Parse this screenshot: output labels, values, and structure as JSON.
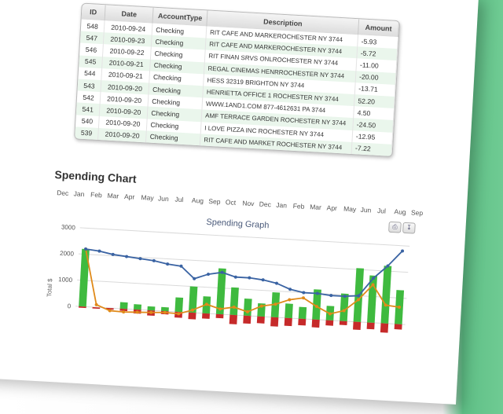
{
  "table": {
    "headers": [
      "ID",
      "Date",
      "AccountType",
      "Description",
      "Amount"
    ],
    "rows": [
      [
        "548",
        "2010-09-24",
        "Checking",
        "RIT CAFE AND MARKEROCHESTER NY 3744",
        "-5.93"
      ],
      [
        "547",
        "2010-09-23",
        "Checking",
        "RIT CAFE AND MARKEROCHESTER NY 3744",
        "-5.72"
      ],
      [
        "546",
        "2010-09-22",
        "Checking",
        "RIT FINAN SRVS ONLROCHESTER NY 3744",
        "-11.00"
      ],
      [
        "545",
        "2010-09-21",
        "Checking",
        "REGAL CINEMAS HENRROCHESTER NY 3744",
        "-20.00"
      ],
      [
        "544",
        "2010-09-21",
        "Checking",
        "HESS 32319 BRIGHTON NY 3744",
        "-13.71"
      ],
      [
        "543",
        "2010-09-20",
        "Checking",
        "HENRIETTA OFFICE 1 ROCHESTER NY 3744",
        "52.20"
      ],
      [
        "542",
        "2010-09-20",
        "Checking",
        "WWW.1AND1.COM 877-4612631 PA 3744",
        "4.50"
      ],
      [
        "541",
        "2010-09-20",
        "Checking",
        "AMF TERRACE GARDEN ROCHESTER NY 3744",
        "-24.50"
      ],
      [
        "540",
        "2010-09-20",
        "Checking",
        "I LOVE PIZZA INC ROCHESTER NY 3744",
        "-12.95"
      ],
      [
        "539",
        "2010-09-20",
        "Checking",
        "RIT CAFE AND MARKET ROCHESTER NY 3744",
        "-7.22"
      ]
    ]
  },
  "section_title": "Spending Chart",
  "months": [
    "Dec",
    "Jan",
    "Feb",
    "Mar",
    "Apr",
    "May",
    "Jun",
    "Jul",
    "Aug",
    "Sep",
    "Oct",
    "Nov",
    "Dec",
    "Jan",
    "Feb",
    "Mar",
    "Apr",
    "May",
    "Jun",
    "Jul",
    "Aug",
    "Sep"
  ],
  "chart_data": {
    "type": "bar",
    "title": "Spending Graph",
    "ylabel": "Total $",
    "y_ticks": [
      "3000",
      "2000",
      "1000",
      "0"
    ],
    "ylim": [
      -400,
      3000
    ],
    "bar_positive": [
      2200,
      0,
      0,
      250,
      200,
      150,
      150,
      550,
      1000,
      650,
      1750,
      1050,
      650,
      500,
      950,
      550,
      450,
      1150,
      550,
      1050,
      2050,
      1800,
      2200,
      1300
    ],
    "bar_negative": [
      -50,
      -50,
      -60,
      -80,
      -150,
      -200,
      -120,
      -220,
      -250,
      -200,
      -150,
      -350,
      -300,
      -260,
      -350,
      -300,
      -250,
      -300,
      -200,
      -150,
      -300,
      -250,
      -350,
      -200
    ],
    "line_blue": [
      2200,
      2150,
      2050,
      2000,
      1950,
      1900,
      1800,
      1750,
      1300,
      1500,
      1600,
      1450,
      1450,
      1400,
      1300,
      1100,
      1000,
      1000,
      950,
      950,
      1000,
      1700,
      2200,
      2800
    ],
    "line_orange": [
      2200,
      100,
      -100,
      -120,
      -100,
      -80,
      -50,
      -70,
      100,
      350,
      200,
      300,
      150,
      400,
      500,
      700,
      800,
      500,
      250,
      400,
      850,
      1450,
      700,
      650
    ],
    "colors": {
      "green": "#3fba3f",
      "red": "#c62a2a",
      "blue": "#3a63a3",
      "orange": "#e08a1a"
    }
  },
  "toolbar": {
    "print_icon": "print-icon",
    "export_icon": "export-icon"
  }
}
